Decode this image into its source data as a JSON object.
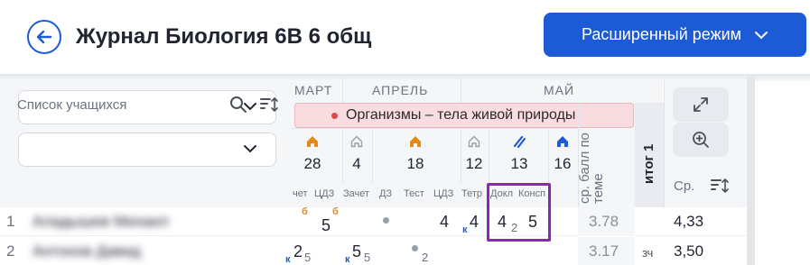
{
  "header": {
    "title": "Журнал Биология 6В 6 общ",
    "mode_button": "Расширенный режим"
  },
  "left_panel": {
    "students_label": "Список учащихся"
  },
  "months": [
    "МАРТ",
    "АПРЕЛЬ",
    "МАЙ"
  ],
  "topic": "Организмы – тела живой природы",
  "days": [
    "28",
    "4",
    "18",
    "12",
    "13",
    "16"
  ],
  "day_icons": [
    "home-orange-icon",
    "home-grey-icon",
    "home-orange-icon",
    "home-grey-icon",
    "slash-blue-icon",
    "home-blue-icon"
  ],
  "columns": [
    "чет",
    "ЦДЗ",
    "Зачет",
    "ДЗ",
    "Тест",
    "ЦДЗ",
    "Тетр",
    "Докл",
    "Консп"
  ],
  "avg_header": "ср. балл по теме",
  "itog_header": "итог 1",
  "right_panel": {
    "avg_label": "Ср."
  },
  "rows": [
    {
      "num": "1",
      "name": "Аладышев Михаил",
      "badge_a": "б",
      "mark_a": "5",
      "badge_b": "б",
      "mark_b": "4",
      "k_b": "к",
      "mark_c": "4",
      "mark_c_sub": "2",
      "mark_d": "5",
      "avg": "3.78",
      "final": "4,33"
    },
    {
      "num": "2",
      "name": "Антонов Давид",
      "k_a": "к",
      "mark_a": "2",
      "mark_a_sub": "5",
      "k_b": "к",
      "mark_b": "5",
      "mark_b_sub": "5",
      "mark_c_sub": "2",
      "avg": "3.17",
      "itog": "зч",
      "final": "3,50"
    }
  ],
  "colors": {
    "accent": "#1d5bd6",
    "topic_bg": "#f9dcdf",
    "highlight": "#8b25b8",
    "badge": "#e28a1c"
  }
}
